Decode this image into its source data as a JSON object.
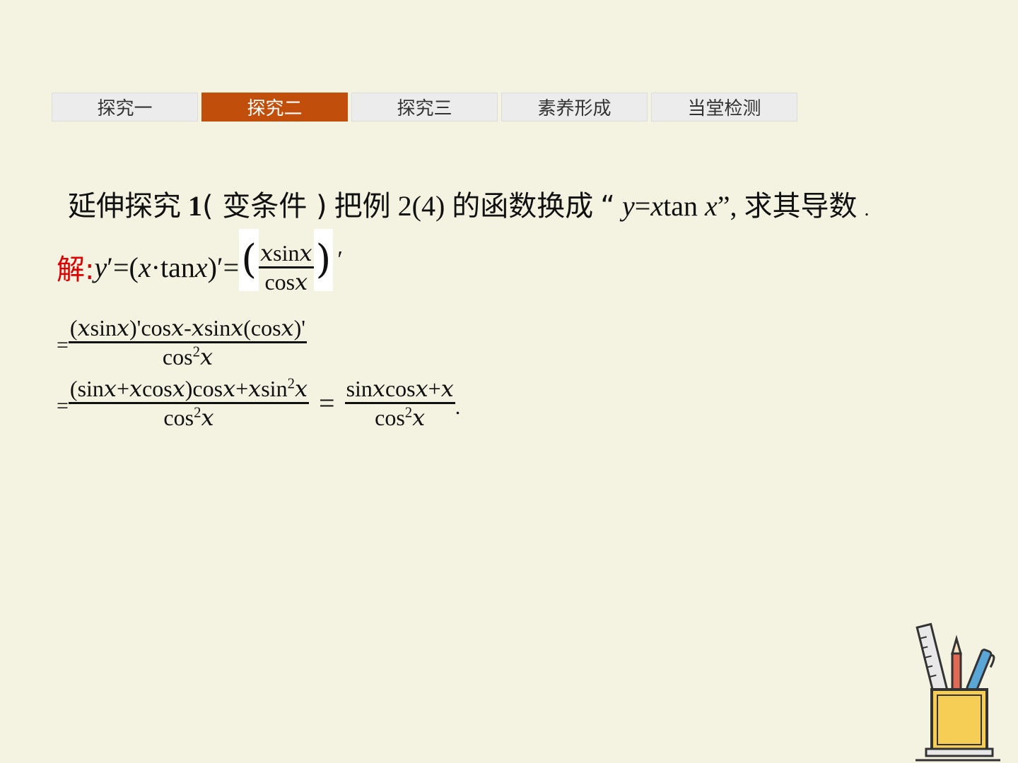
{
  "tabs": [
    {
      "label": "探究一",
      "active": false
    },
    {
      "label": "探究二",
      "active": true
    },
    {
      "label": "探究三",
      "active": false
    },
    {
      "label": "素养形成",
      "active": false
    },
    {
      "label": "当堂检测",
      "active": false
    }
  ],
  "question": {
    "title": "延伸探究",
    "number": "1",
    "condition": "( 变条件 )",
    "text1": "把例",
    "example": "2(4)",
    "text2": "的函数换成",
    "quote_open": "“",
    "func_y": "y",
    "func_eq": "=",
    "func_x": "x",
    "func_tan": "tan",
    "func_x2": "x",
    "quote_close": "”,",
    "text3": "求其导数",
    "end": "."
  },
  "solution": {
    "label": "解:",
    "line1": {
      "y": "y",
      "prime_eq_open": "′=(",
      "x": "x",
      "dot_tan": "·tan ",
      "x2": "x",
      "close_prime_eq": ")′=",
      "lparen": "(",
      "num": "𝑥sin𝑥",
      "den": "cos𝑥",
      "rparen": ")",
      "tail": "′"
    },
    "line2": {
      "eq": "=",
      "num": "(𝑥sin𝑥)'cos𝑥-𝑥sin𝑥(cos𝑥)'",
      "den_base": "cos",
      "den_sup": "2",
      "den_var": "𝑥"
    },
    "line3": {
      "eq": "=",
      "num_a": "(sin𝑥+𝑥cos𝑥)cos𝑥+𝑥sin",
      "num_sup": "2",
      "num_b": "𝑥",
      "den_base": "cos",
      "den_sup": "2",
      "den_var": "𝑥",
      "eq2": "=",
      "num2": "sin𝑥cos𝑥+𝑥",
      "den2_base": "cos",
      "den2_sup": "2",
      "den2_var": "𝑥",
      "end": "."
    }
  },
  "colors": {
    "background": "#f4f2e1",
    "tab_active": "#c24e0c",
    "tab_inactive": "#ececec",
    "solution_label": "#e00000"
  },
  "icons": [
    "pencil-cup-icon"
  ]
}
